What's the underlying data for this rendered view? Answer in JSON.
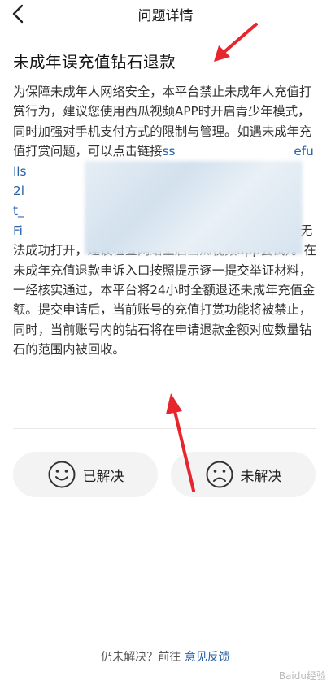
{
  "header": {
    "title": "问题详情",
    "back_icon": "chevron-left-icon"
  },
  "question": {
    "title": "未成年误充值钻石退款",
    "body_before_link": "为保障未成年人网络安全，本平台禁止未成年人充值打赏行为，建议您使用西瓜视频APP时开启青少年模式，同时加强对手机支付方式的限制与管理。如遇未成年充值打赏问题，可以点击链接",
    "link_visible": "ss                              efu\nlls                              F%\n2l                               ast\nt_                               %2\nFi                               ition",
    "link_tail": "on",
    "body_after_link": "申请退款（如遇链接无法成功打开，建议检查网络重启西瓜视频app尝试）。在未成年充值退款申诉入口按照提示逐一提交举证材料，一经核实通过，本平台将24小时全额退还未成年充值金额。提交申请后，当前账号的充值打赏功能将被禁止，同时，当前账号内的钻石将在申请退款金额对应数量钻石的范围内被回收。"
  },
  "feedback": {
    "solved_label": "已解决",
    "unsolved_label": "未解决"
  },
  "footer": {
    "prompt": "仍未解决？前往 ",
    "link": "意见反馈"
  },
  "watermark": "Baidu经验",
  "colors": {
    "link": "#2a62a6",
    "arrow": "#e8242c",
    "button_bg": "#f3f3f3"
  }
}
